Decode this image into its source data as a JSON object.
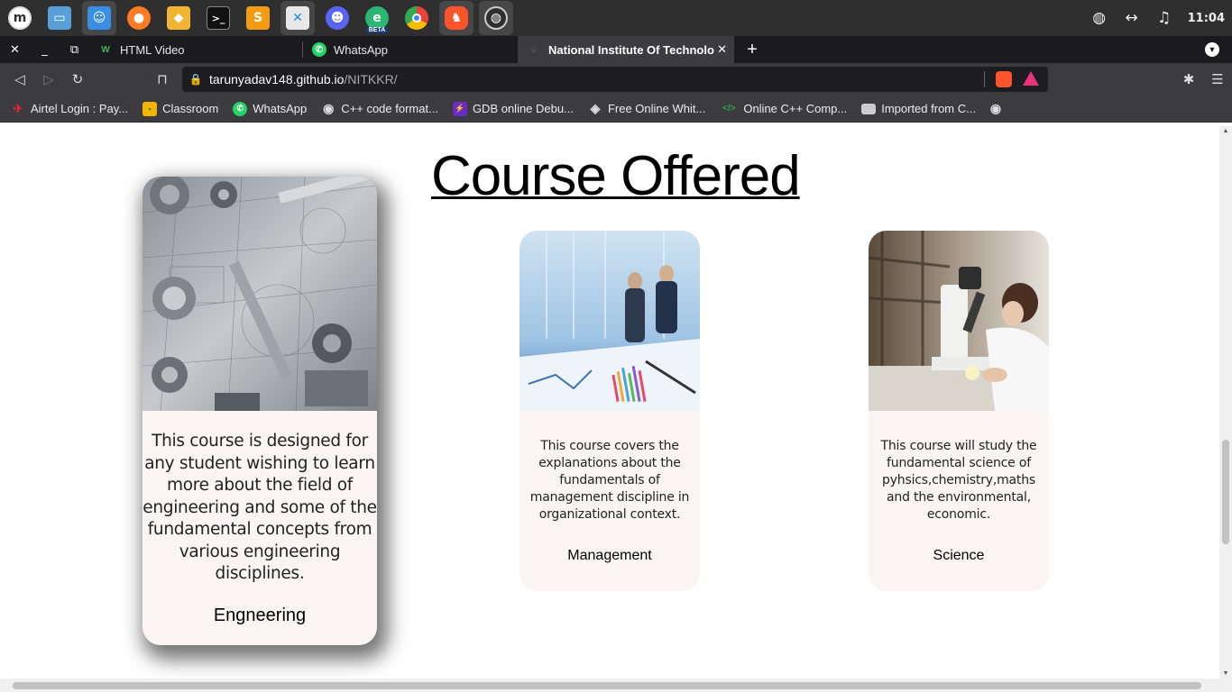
{
  "taskbar": {
    "apps": [
      "menu",
      "files",
      "finder",
      "firefox",
      "genie",
      "terminal",
      "sublime",
      "vscode",
      "discord",
      "edge-beta",
      "chrome",
      "brave",
      "obs"
    ],
    "edge_badge": "BETA",
    "clock": "11:04"
  },
  "tabs": [
    {
      "title": "HTML Video",
      "favicon": "W",
      "color": "#3fb950"
    },
    {
      "title": "WhatsApp",
      "favicon": "✆",
      "color": "#25d366"
    },
    {
      "title": "National Institute Of Technolo",
      "favicon": "◌",
      "color": "#777777",
      "active": true
    }
  ],
  "toolbar": {
    "url_host": "tarunyadav148.github.io",
    "url_path": "/NITKKR/"
  },
  "bookmarks": [
    {
      "label": "Airtel Login : Pay...",
      "color": "#e3262e",
      "glyph": "✈"
    },
    {
      "label": "Classroom",
      "color": "#f5b400",
      "glyph": "▪"
    },
    {
      "label": "WhatsApp",
      "color": "#25d366",
      "glyph": "✆"
    },
    {
      "label": "C++ code format...",
      "color": "#dddddd",
      "glyph": "◉"
    },
    {
      "label": "GDB online Debu...",
      "color": "#6a2cc2",
      "glyph": "⚡"
    },
    {
      "label": "Free Online Whit...",
      "color": "#dddddd",
      "glyph": "◈"
    },
    {
      "label": "Online C++ Comp...",
      "color": "#2ea44f",
      "glyph": "</>"
    },
    {
      "label": "Imported from C...",
      "color": "#cccccc",
      "glyph": "▬"
    }
  ],
  "page": {
    "title": "Course Offered",
    "courses": [
      {
        "name": "Engneering",
        "description": "This course is designed for any student wishing to learn more about the field of engineering and some of the fundamental concepts from various engineering disciplines.",
        "image": "engineering-tools"
      },
      {
        "name": "Management",
        "description": "This course covers the explanations about the fundamentals of management discipline in organizational context.",
        "image": "business-meeting"
      },
      {
        "name": "Science",
        "description": "This course will study the fundamental science of pyhsics,chemistry,maths and the environmental, economic.",
        "image": "microscope-lab"
      }
    ]
  }
}
